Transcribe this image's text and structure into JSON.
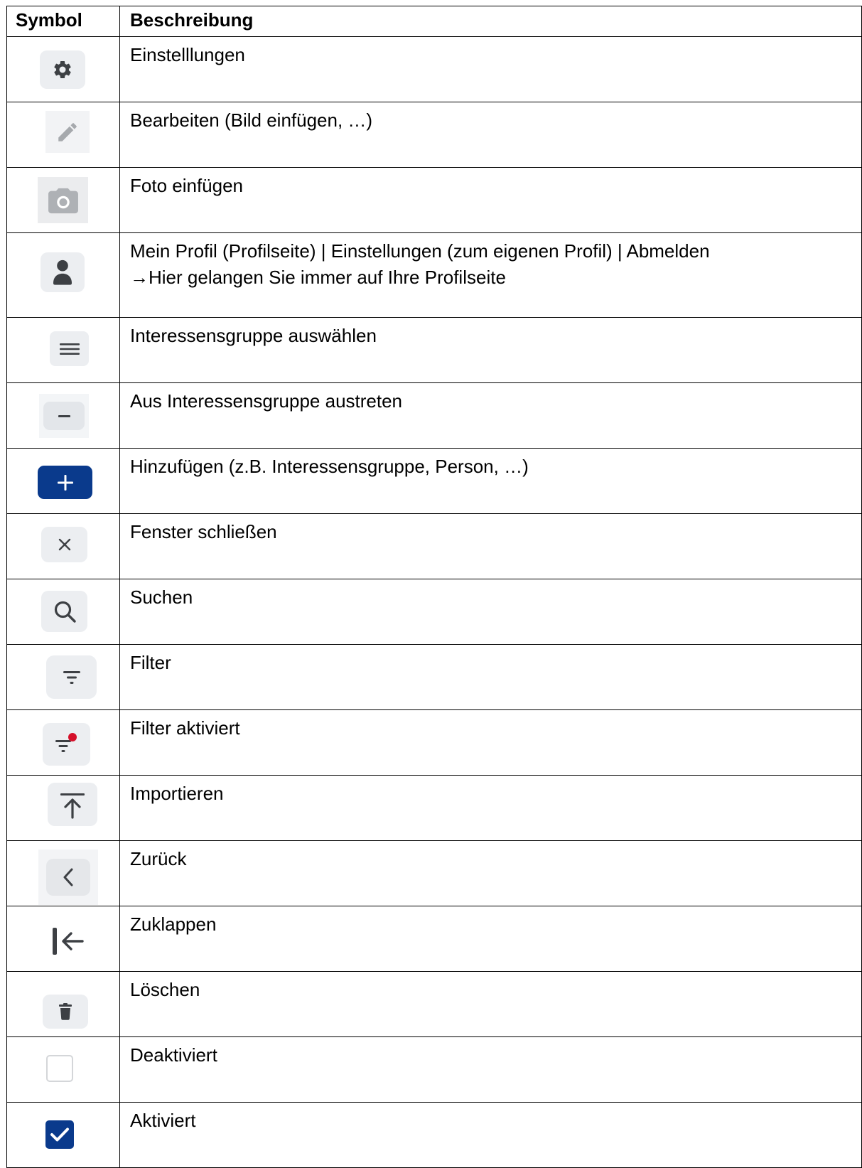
{
  "header": {
    "symbol": "Symbol",
    "description": "Beschreibung"
  },
  "rows": [
    {
      "icon": "gear-icon",
      "description": "Einstelllungen"
    },
    {
      "icon": "pencil-icon",
      "description": "Bearbeiten (Bild einfügen, …)"
    },
    {
      "icon": "camera-icon",
      "description": "Foto einfügen"
    },
    {
      "icon": "person-icon",
      "description": "Mein Profil (Profilseite) | Einstellungen (zum eigenen Profil) | Abmelden\n→Hier gelangen Sie immer auf Ihre Profilseite"
    },
    {
      "icon": "menu-icon",
      "description": "Interessensgruppe auswählen"
    },
    {
      "icon": "minus-icon",
      "description": "Aus Interessensgruppe austreten"
    },
    {
      "icon": "plus-icon",
      "description": "Hinzufügen (z.B. Interessensgruppe, Person, …)"
    },
    {
      "icon": "close-icon",
      "description": "Fenster schließen"
    },
    {
      "icon": "search-icon",
      "description": "Suchen"
    },
    {
      "icon": "filter-icon",
      "description": "Filter"
    },
    {
      "icon": "filter-active-icon",
      "description": "Filter aktiviert"
    },
    {
      "icon": "import-icon",
      "description": "Importieren"
    },
    {
      "icon": "chevron-left-icon",
      "description": "Zurück"
    },
    {
      "icon": "collapse-icon",
      "description": "Zuklappen"
    },
    {
      "icon": "trash-icon",
      "description": "Löschen"
    },
    {
      "icon": "checkbox-unchecked-icon",
      "description": "Deaktiviert"
    },
    {
      "icon": "checkbox-checked-icon",
      "description": "Aktiviert"
    }
  ],
  "colors": {
    "icon_bg": "#eceef1",
    "icon_fg": "#3d4044",
    "primary": "#0a3a8c",
    "active_dot": "#d5102a"
  }
}
